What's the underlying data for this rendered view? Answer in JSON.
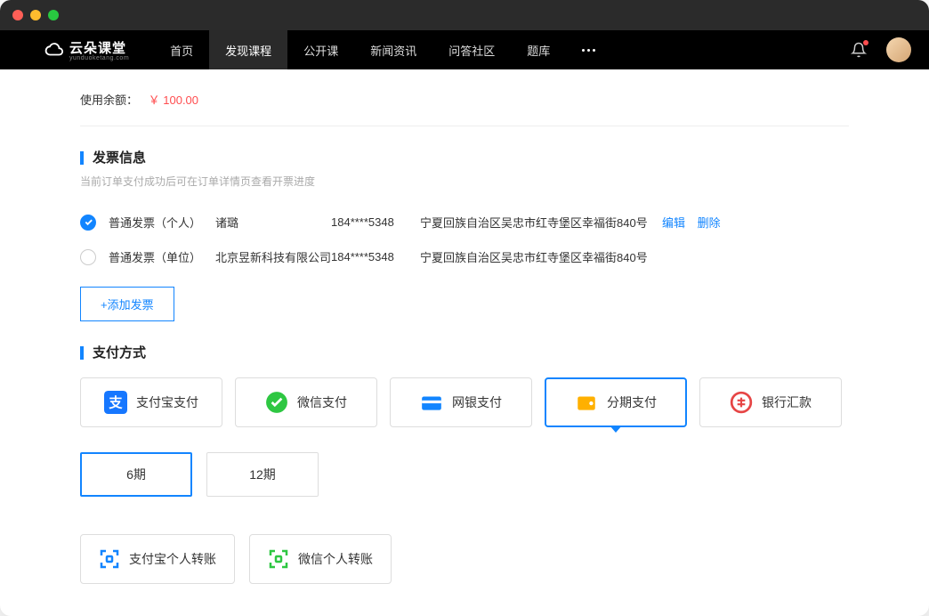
{
  "nav": {
    "brand": "云朵课堂",
    "brand_sub": "yunduoketang.com",
    "items": [
      "首页",
      "发现课程",
      "公开课",
      "新闻资讯",
      "问答社区",
      "题库"
    ],
    "active_index": 1
  },
  "balance": {
    "label": "使用余额：",
    "amount": "￥ 100.00"
  },
  "invoice": {
    "title": "发票信息",
    "subtitle": "当前订单支付成功后可在订单详情页查看开票进度",
    "rows": [
      {
        "type": "普通发票（个人）",
        "name": "诸璐",
        "phone": "184****5348",
        "address": "宁夏回族自治区吴忠市红寺堡区幸福街840号",
        "checked": true,
        "edit": "编辑",
        "delete": "删除"
      },
      {
        "type": "普通发票（单位）",
        "name": "北京昱新科技有限公司",
        "phone": "184****5348",
        "address": "宁夏回族自治区吴忠市红寺堡区幸福街840号",
        "checked": false
      }
    ],
    "add_label": "+添加发票"
  },
  "payment": {
    "title": "支付方式",
    "methods": [
      {
        "label": "支付宝支付",
        "icon": "alipay"
      },
      {
        "label": "微信支付",
        "icon": "wechat"
      },
      {
        "label": "网银支付",
        "icon": "bank"
      },
      {
        "label": "分期支付",
        "icon": "wallet",
        "selected": true
      },
      {
        "label": "银行汇款",
        "icon": "remit"
      }
    ],
    "installments": [
      {
        "label": "6期",
        "selected": true
      },
      {
        "label": "12期",
        "selected": false
      }
    ],
    "transfers": [
      {
        "label": "支付宝个人转账",
        "color": "blue"
      },
      {
        "label": "微信个人转账",
        "color": "green"
      }
    ]
  }
}
